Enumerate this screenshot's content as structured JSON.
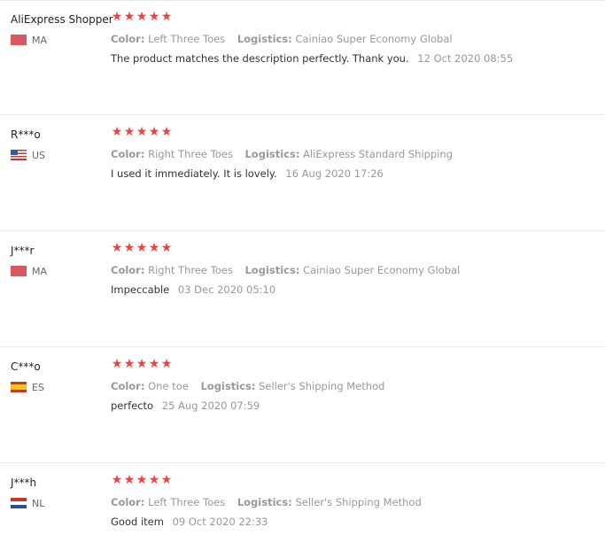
{
  "colors": {
    "star": "#f04040",
    "divider": "#e8e8e8",
    "muted_text": "#999999",
    "body_text": "#333333"
  },
  "labels": {
    "color": "Color:",
    "logistics": "Logistics:"
  },
  "reviews": [
    {
      "user": "AliExpress Shopper",
      "flag_icon": "morocco-flag-icon",
      "country": "MA",
      "rating": 5,
      "color": "Left Three Toes",
      "logistics": "Cainiao Super Economy Global",
      "text": "The product matches the description perfectly. Thank you.",
      "date": "12 Oct 2020 08:55"
    },
    {
      "user": "R***o",
      "flag_icon": "usa-flag-icon",
      "country": "US",
      "rating": 5,
      "color": "Right Three Toes",
      "logistics": "AliExpress Standard Shipping",
      "text": "I used it immediately. It is lovely.",
      "date": "16 Aug 2020 17:26"
    },
    {
      "user": "J***r",
      "flag_icon": "morocco-flag-icon",
      "country": "MA",
      "rating": 5,
      "color": "Right Three Toes",
      "logistics": "Cainiao Super Economy Global",
      "text": "Impeccable",
      "date": "03 Dec 2020 05:10"
    },
    {
      "user": "C***o",
      "flag_icon": "spain-flag-icon",
      "country": "ES",
      "rating": 5,
      "color": "One toe",
      "logistics": "Seller's Shipping Method",
      "text": "perfecto",
      "date": "25 Aug 2020 07:59"
    },
    {
      "user": "J***h",
      "flag_icon": "netherlands-flag-icon",
      "country": "NL",
      "rating": 5,
      "color": "Left Three Toes",
      "logistics": "Seller's Shipping Method",
      "text": "Good item",
      "date": "09 Oct 2020 22:33"
    }
  ]
}
